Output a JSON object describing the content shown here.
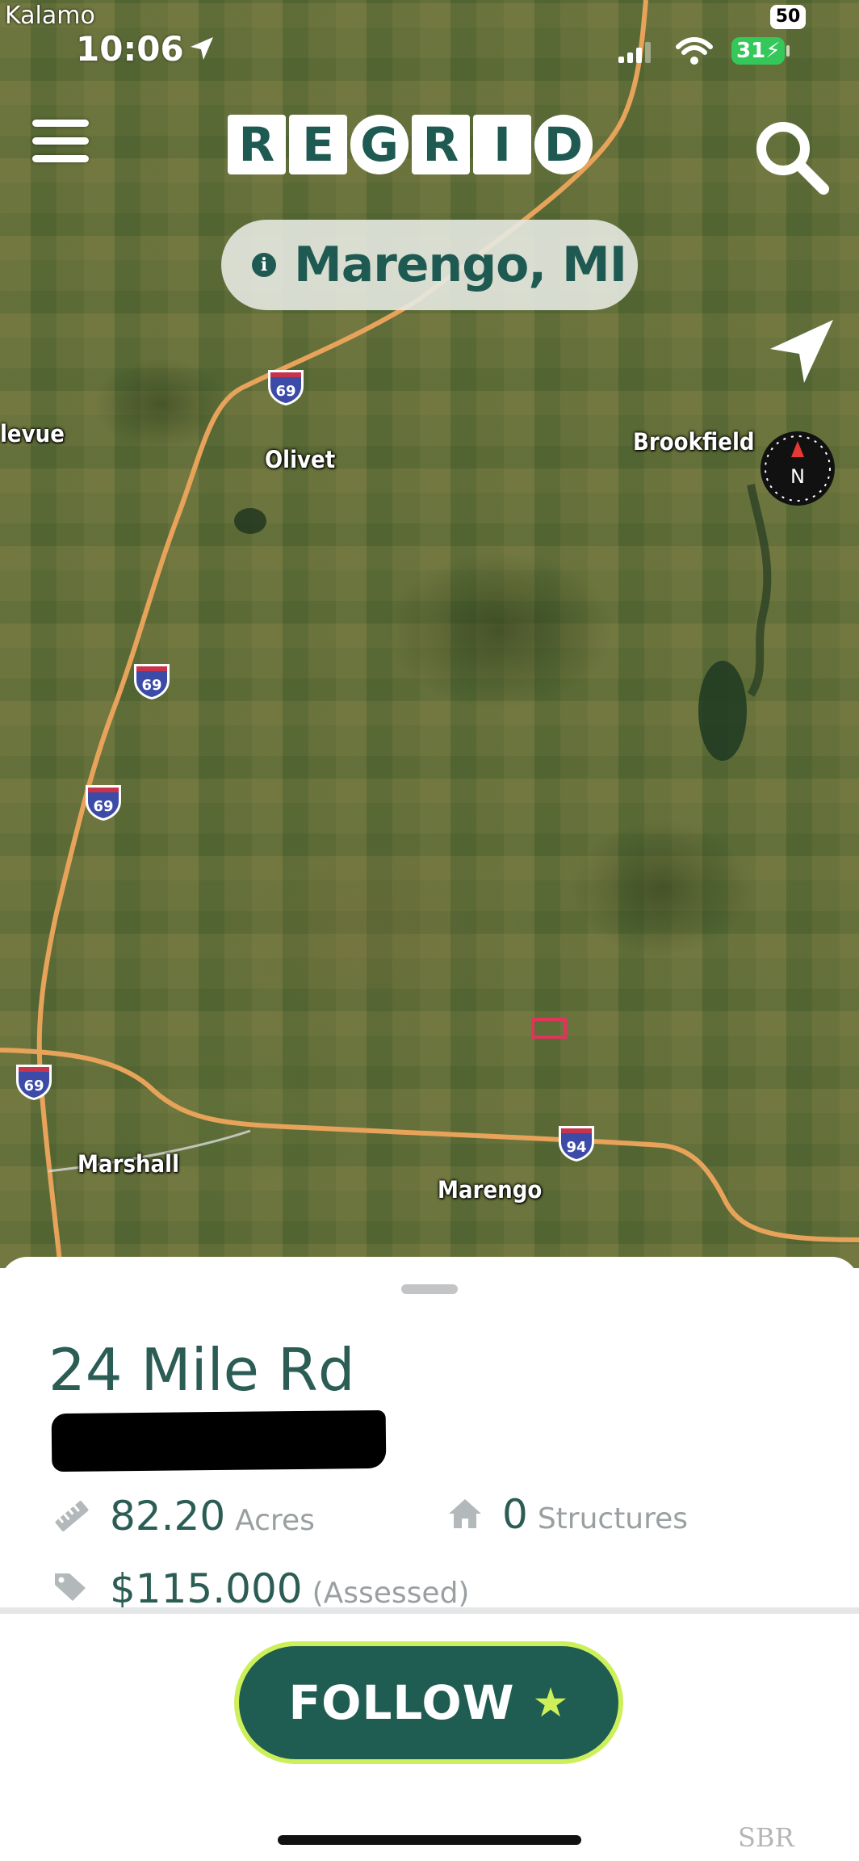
{
  "status_bar": {
    "back_app": "Kalamo",
    "time": "10:06",
    "battery": "31",
    "network_badge": "50"
  },
  "app": {
    "logo_letters": [
      "R",
      "E",
      "G",
      "R",
      "I",
      "D"
    ]
  },
  "location_pill": {
    "text": "Marengo, MI"
  },
  "map": {
    "labels": {
      "bellevue": "levue",
      "olivet": "Olivet",
      "brookfield": "Brookfield",
      "marshall": "Marshall",
      "marengo": "Marengo"
    },
    "shields": {
      "i69_a": "69",
      "i69_b": "69",
      "i69_c": "69",
      "i69_d": "69",
      "i94": "94"
    },
    "compass_letter": "N"
  },
  "parcel": {
    "address": "24 Mile Rd",
    "acres_value": "82.20",
    "acres_unit": "Acres",
    "structures_value": "0",
    "structures_unit": "Structures",
    "assessed_value": "$115.000",
    "assessed_unit": "(Assessed)"
  },
  "actions": {
    "follow_label": "FOLLOW",
    "follow_star": "★"
  },
  "watermark": "SBR",
  "colors": {
    "brand": "#1e5a52",
    "accent": "#cdf05a",
    "road": "#e8a35a",
    "parcel_outline": "#e0355a"
  }
}
